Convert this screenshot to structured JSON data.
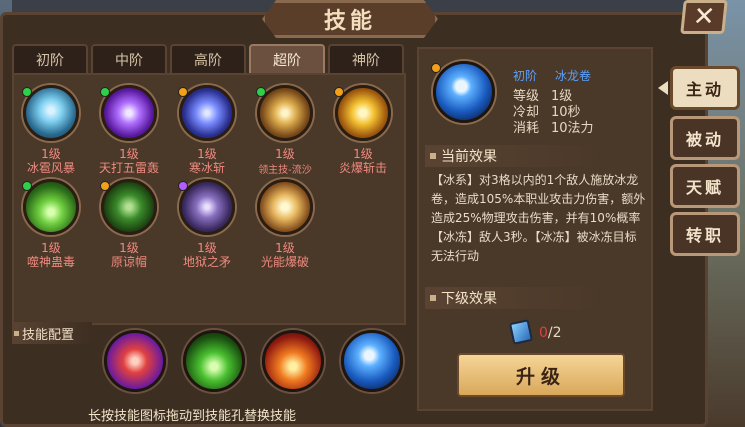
{
  "window": {
    "title": "技能",
    "close_icon": "close-icon"
  },
  "tabs": [
    "初阶",
    "中阶",
    "高阶",
    "超阶",
    "神阶"
  ],
  "active_tab": 3,
  "skills": [
    {
      "level": "1级",
      "name": "冰雹风暴",
      "badge_color": "#2fcf4a",
      "icon": "hail-storm-icon"
    },
    {
      "level": "1级",
      "name": "天打五雷轰",
      "badge_color": "#2fcf4a",
      "icon": "thunder-icon"
    },
    {
      "level": "1级",
      "name": "寒冰斩",
      "badge_color": "#f2a01b",
      "icon": "ice-slash-icon"
    },
    {
      "level": "1级",
      "name": "领主技-流沙",
      "badge_color": "#2fcf4a",
      "icon": "quicksand-icon"
    },
    {
      "level": "1级",
      "name": "炎爆斩击",
      "badge_color": "#f2a01b",
      "icon": "flame-slash-icon"
    },
    {
      "level": "1级",
      "name": "噬神蛊毒",
      "badge_color": "#2fcf4a",
      "icon": "poison-icon"
    },
    {
      "level": "1级",
      "name": "原谅帽",
      "badge_color": "#f2a01b",
      "icon": "hat-icon"
    },
    {
      "level": "1级",
      "name": "地狱之矛",
      "badge_color": "#b35cff",
      "icon": "spear-icon"
    },
    {
      "level": "1级",
      "name": "光能爆破",
      "badge_color": "",
      "icon": "light-blast-icon"
    }
  ],
  "config": {
    "label": "技能配置",
    "slots": [
      "fist-icon",
      "green-flame-icon",
      "fire-icon",
      "tornado-icon"
    ],
    "hint": "长按技能图标拖动到技能孔替换技能"
  },
  "detail": {
    "tier": "初阶",
    "name": "冰龙卷",
    "level_label": "等级",
    "level_value": "1级",
    "cooldown_label": "冷却",
    "cooldown_value": "10秒",
    "cost_label": "消耗",
    "cost_value": "10法力",
    "current_title": "当前效果",
    "current_text": "【冰系】对3格以内的1个敌人施放冰龙卷，造成105%本职业攻击力伤害，额外造成25%物理攻击伤害，并有10%概率【冰冻】敌人3秒。【冰冻】被冰冻目标无法行动",
    "next_title": "下级效果",
    "book_have": "0",
    "book_need": "/2",
    "upgrade_label": "升级"
  },
  "side_tabs": [
    "主动",
    "被动",
    "天赋",
    "转职"
  ],
  "active_side": 0
}
